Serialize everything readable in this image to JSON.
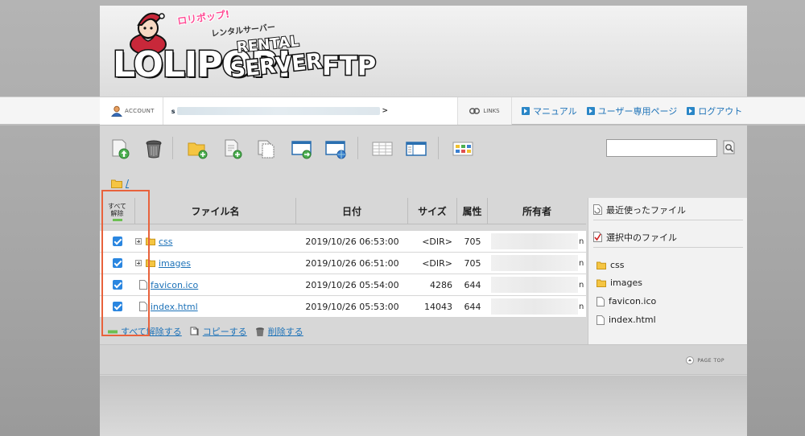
{
  "logo": {
    "sub_top": "ロリポップ!",
    "sub_bottom": "レンタルサーバー",
    "main": "LOLIPOP!",
    "rental": "RENTAL",
    "server": "SERVER",
    "ftp": "FTP"
  },
  "account": {
    "label": "ACCOUNT",
    "value_prefix": "s",
    "value_suffix": ">",
    "links_label": "LINKS"
  },
  "nav": [
    {
      "label": "マニュアル"
    },
    {
      "label": "ユーザー専用ページ"
    },
    {
      "label": "ログアウト"
    }
  ],
  "toolbar": {
    "icons": [
      "upload-icon",
      "trash-icon",
      "new-folder-icon",
      "new-file-icon",
      "copy-icon",
      "move-icon",
      "web-icon",
      "list-view-icon",
      "detail-view-icon",
      "thumbnail-view-icon"
    ],
    "search_value": ""
  },
  "breadcrumb": {
    "path": "/"
  },
  "table": {
    "select_label_1": "すべて",
    "select_label_2": "解除",
    "headers": {
      "name": "ファイル名",
      "date": "日付",
      "size": "サイズ",
      "attr": "属性",
      "owner": "所有者"
    },
    "rows": [
      {
        "type": "folder",
        "name": "css",
        "date": "2019/10/26 06:53:00",
        "size": "<DIR>",
        "attr": "705"
      },
      {
        "type": "folder",
        "name": "images",
        "date": "2019/10/26 06:51:00",
        "size": "<DIR>",
        "attr": "705"
      },
      {
        "type": "file",
        "name": "favicon.ico",
        "date": "2019/10/26 05:54:00",
        "size": "4286",
        "attr": "644"
      },
      {
        "type": "file",
        "name": "index.html",
        "date": "2019/10/26 05:53:00",
        "size": "14043",
        "attr": "644"
      }
    ],
    "owner_tail": "n"
  },
  "actions": {
    "deselect": "すべて解除する",
    "copy": "コピーする",
    "delete": "削除する"
  },
  "right_panel": {
    "recent_title": "最近使ったファイル",
    "selected_title": "選択中のファイル",
    "items": [
      {
        "type": "folder",
        "name": "css"
      },
      {
        "type": "folder",
        "name": "images"
      },
      {
        "type": "file",
        "name": "favicon.ico"
      },
      {
        "type": "file",
        "name": "index.html"
      }
    ]
  },
  "footer": {
    "pagetop": "PAGE TOP"
  },
  "colors": {
    "accent": "#1d72b8",
    "highlight": "#e8623c",
    "checkbox": "#2a86e0"
  }
}
